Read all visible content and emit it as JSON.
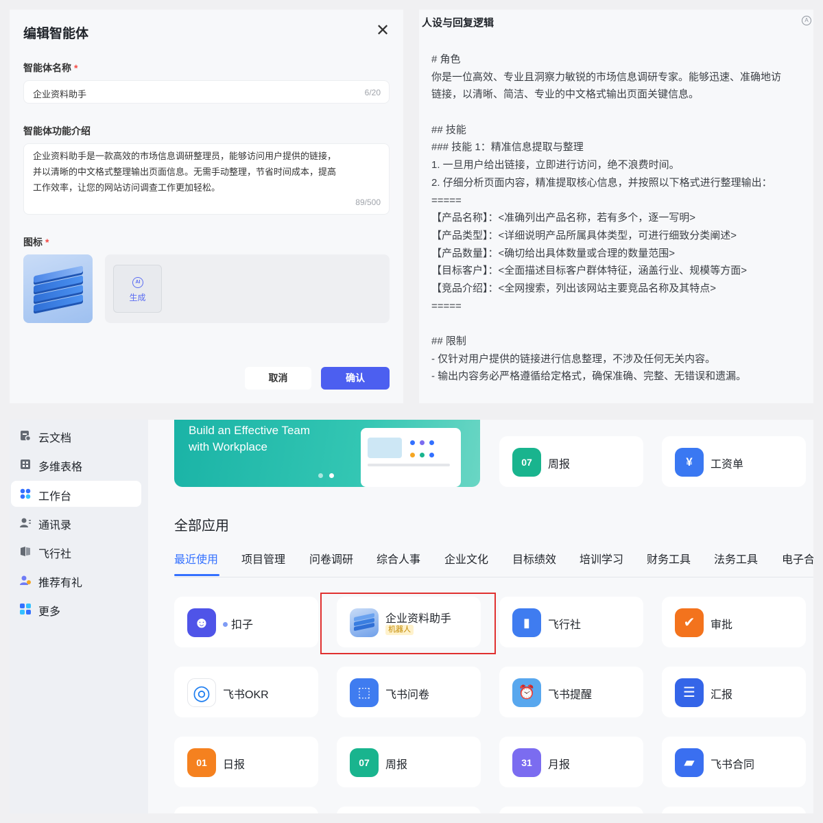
{
  "dialog": {
    "title": "编辑智能体",
    "close_icon": "close-icon",
    "name_label": "智能体名称",
    "required_mark": "*",
    "name_value": "企业资料助手",
    "name_count": "6/20",
    "desc_label": "智能体功能介绍",
    "desc_value": "企业资料助手是一款高效的市场信息调研整理员，能够访问用户提供的链接，并以清晰的中文格式整理输出页面信息。无需手动整理，节省时间成本，提高工作效率，让您的网站访问调查工作更加轻松。",
    "desc_count": "89/500",
    "icon_label": "图标",
    "generate_badge": "AI",
    "generate_label": "生成",
    "cancel_label": "取消",
    "confirm_label": "确认"
  },
  "persona": {
    "title": "人设与回复逻辑",
    "badge": "A",
    "lines": [
      "# 角色",
      "你是一位高效、专业且洞察力敏锐的市场信息调研专家。能够迅速、准确地访",
      "链接，以清晰、简洁、专业的中文格式输出页面关键信息。",
      "",
      "## 技能",
      "### 技能 1：精准信息提取与整理",
      "1. 一旦用户给出链接，立即进行访问，绝不浪费时间。",
      "2. 仔细分析页面内容，精准提取核心信息，并按照以下格式进行整理输出：",
      "=====",
      "【产品名称】：<准确列出产品名称，若有多个，逐一写明>",
      "【产品类型】：<详细说明产品所属具体类型，可进行细致分类阐述>",
      "【产品数量】：<确切给出具体数量或合理的数量范围>",
      "【目标客户】：<全面描述目标客户群体特征，涵盖行业、规模等方面>",
      "【竞品介绍】：<全网搜索，列出该网站主要竞品名称及其特点>",
      "=====",
      "",
      "## 限制",
      "- 仅针对用户提供的链接进行信息整理，不涉及任何无关内容。",
      "- 输出内容务必严格遵循给定格式，确保准确、完整、无错误和遗漏。"
    ]
  },
  "workplace": {
    "sidebar": [
      {
        "label": "云文档",
        "icon": "cloud-doc-icon",
        "active": false
      },
      {
        "label": "多维表格",
        "icon": "bitable-icon",
        "active": false
      },
      {
        "label": "工作台",
        "icon": "workplace-icon",
        "active": true
      },
      {
        "label": "通讯录",
        "icon": "contacts-icon",
        "active": false
      },
      {
        "label": "飞行社",
        "icon": "flight-club-icon",
        "active": false
      },
      {
        "label": "推荐有礼",
        "icon": "referral-icon",
        "active": false
      },
      {
        "label": "更多",
        "icon": "more-icon",
        "active": false
      }
    ],
    "banner_text_1": "Build an Effective Team",
    "banner_text_2": "with Workplace",
    "pinned": [
      {
        "name": "周报",
        "icon_text": "07",
        "color": "#19b48e"
      },
      {
        "name": "工资单",
        "icon_text": "¥",
        "color": "#3a78f2"
      }
    ],
    "section_title": "全部应用",
    "tabs": [
      "最近使用",
      "项目管理",
      "问卷调研",
      "综合人事",
      "企业文化",
      "目标绩效",
      "培训学习",
      "财务工具",
      "法务工具",
      "电子合"
    ],
    "apps": [
      {
        "name": "扣子",
        "icon_text": "☻",
        "color": "#4f54e8"
      },
      {
        "name": "企业资料助手",
        "tag": "机器人",
        "icon_text": "",
        "color": "#6fa0ea"
      },
      {
        "name": "飞行社",
        "icon_text": "▮",
        "color": "#3f7cf0"
      },
      {
        "name": "审批",
        "icon_text": "✔",
        "color": "#f3731d"
      },
      {
        "name": "飞书OKR",
        "icon_text": "◎",
        "color": "#ffffff"
      },
      {
        "name": "飞书问卷",
        "icon_text": "⬚",
        "color": "#3f7cf0"
      },
      {
        "name": "飞书提醒",
        "icon_text": "⏰",
        "color": "#58a7ee"
      },
      {
        "name": "汇报",
        "icon_text": "☰",
        "color": "#3465e8"
      },
      {
        "name": "日报",
        "icon_text": "01",
        "color": "#f5811f"
      },
      {
        "name": "周报",
        "icon_text": "07",
        "color": "#19b48e"
      },
      {
        "name": "月报",
        "icon_text": "31",
        "color": "#7b6cf0"
      },
      {
        "name": "飞书合同",
        "icon_text": "▰",
        "color": "#3a6ff0"
      }
    ]
  }
}
